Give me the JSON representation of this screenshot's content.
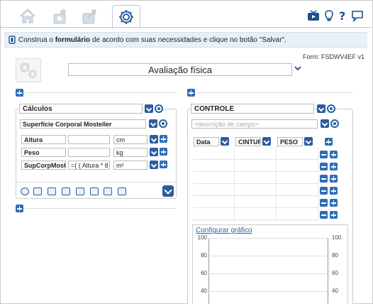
{
  "toolbar": {
    "tabs": [
      {
        "name": "home",
        "icon": "home-icon"
      },
      {
        "name": "users",
        "icon": "users-icon"
      },
      {
        "name": "share",
        "icon": "share-icon"
      },
      {
        "name": "settings",
        "icon": "gear-icon",
        "active": true
      }
    ],
    "right_icons": [
      "video-icon",
      "lightbulb-icon",
      "help-icon",
      "chat-icon"
    ]
  },
  "info": {
    "prefix": "Construa o ",
    "bold": "formulário",
    "suffix": " de acordo com suas necessidades e clique no botão \"Salvar\"."
  },
  "form": {
    "code": "Form: FSDWV4EF v1",
    "title": "Avaliação física"
  },
  "left_section": {
    "title": "Cálculos",
    "calc_name": "Superfície Corporal Mosteller",
    "rows": [
      {
        "label": "Altura",
        "value": "",
        "unit": "cm"
      },
      {
        "label": "Peso",
        "value": "",
        "unit": "kg"
      },
      {
        "label": "SupCorpMost",
        "value": "=( ( Altura * 8",
        "unit": "m²"
      }
    ]
  },
  "right_section": {
    "title": "CONTROLE",
    "description_placeholder": "<descrição de campo>",
    "columns": [
      "Data",
      "CINTUR",
      "PESO"
    ],
    "chart_link": "Configurar gráfico"
  },
  "chart_data": {
    "type": "line",
    "y_ticks": [
      100,
      80,
      60,
      40
    ],
    "ylim": [
      40,
      100
    ],
    "series": []
  },
  "colors": {
    "accent": "#2c5d9c",
    "info_bg": "#e8f0f7"
  }
}
